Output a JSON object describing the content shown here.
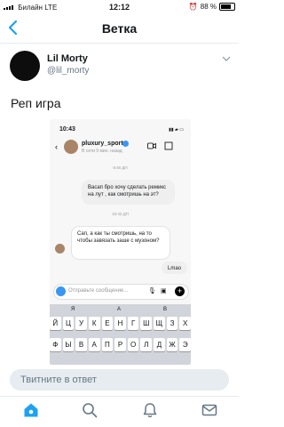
{
  "status_bar": {
    "carrier": "Билайн",
    "network": "LTE",
    "time": "12:12",
    "battery": "88 %"
  },
  "nav": {
    "title": "Ветка"
  },
  "tweet": {
    "display_name": "Lil Morty",
    "handle": "@lil_morty",
    "text": "Реп игра"
  },
  "embedded_chat": {
    "time": "10:43",
    "username": "pluxury_sport",
    "subtitle": "В сети 9 мин. назад",
    "timestamp1": "9:46 ДП",
    "msg_sent_1": "Васап бро хочу сделать ремикс на лут , как смотришь на эт?",
    "timestamp2": "10:42 ДП",
    "msg_received_1": "Сап, а как ты смотришь, на то чтобы завязать заше с музоном?",
    "msg_sent_2": "Lmao",
    "composer_placeholder": "Отправьте сообщение...",
    "suggestions": [
      "Я",
      "А",
      "В"
    ],
    "keyboard_row1": [
      "Й",
      "Ц",
      "У",
      "К",
      "Е",
      "Н",
      "Г",
      "Ш",
      "Щ",
      "З",
      "Х"
    ],
    "keyboard_row2": [
      "Ф",
      "Ы",
      "В",
      "А",
      "П",
      "Р",
      "О",
      "Л",
      "Д",
      "Ж",
      "Э"
    ]
  },
  "reply": {
    "placeholder": "Твитните в ответ"
  },
  "colors": {
    "accent": "#1da1f2",
    "ig_blue": "#3897f0"
  }
}
